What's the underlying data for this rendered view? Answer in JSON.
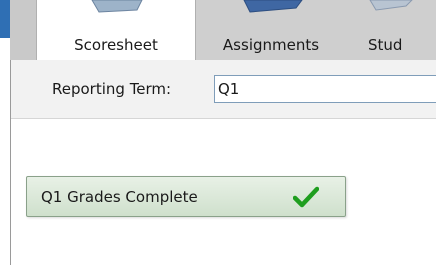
{
  "tabs": [
    {
      "label": "Scoresheet",
      "active": true
    },
    {
      "label": "Assignments",
      "active": false
    },
    {
      "label": "Stud",
      "active": false
    }
  ],
  "reporting_term": {
    "label": "Reporting Term:",
    "value": "Q1"
  },
  "grades_button": {
    "label": "Q1 Grades Complete",
    "icon": "check-icon",
    "icon_color": "#1f9e1f"
  },
  "colors": {
    "accent_blue": "#2f6fb4",
    "button_bg": "#d9e8d5"
  }
}
